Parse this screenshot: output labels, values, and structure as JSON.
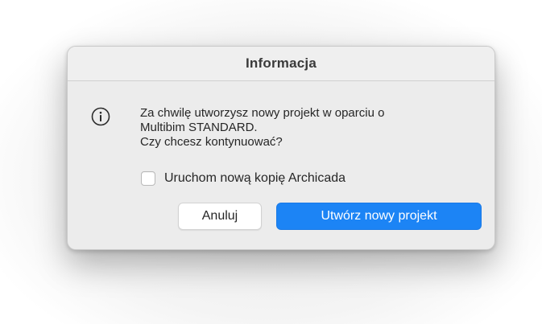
{
  "dialog": {
    "title": "Informacja",
    "icon": "info-icon",
    "message_lines": [
      "Za chwilę utworzysz nowy projekt w oparciu o",
      "Multibim STANDARD.",
      "Czy chcesz kontynuować?"
    ],
    "checkbox": {
      "label": "Uruchom nową kopię Archicada",
      "checked": false
    },
    "buttons": {
      "cancel_label": "Anuluj",
      "primary_label": "Utwórz nowy projekt"
    }
  },
  "colors": {
    "accent": "#1c84f5",
    "dialog_background": "#ececec"
  }
}
